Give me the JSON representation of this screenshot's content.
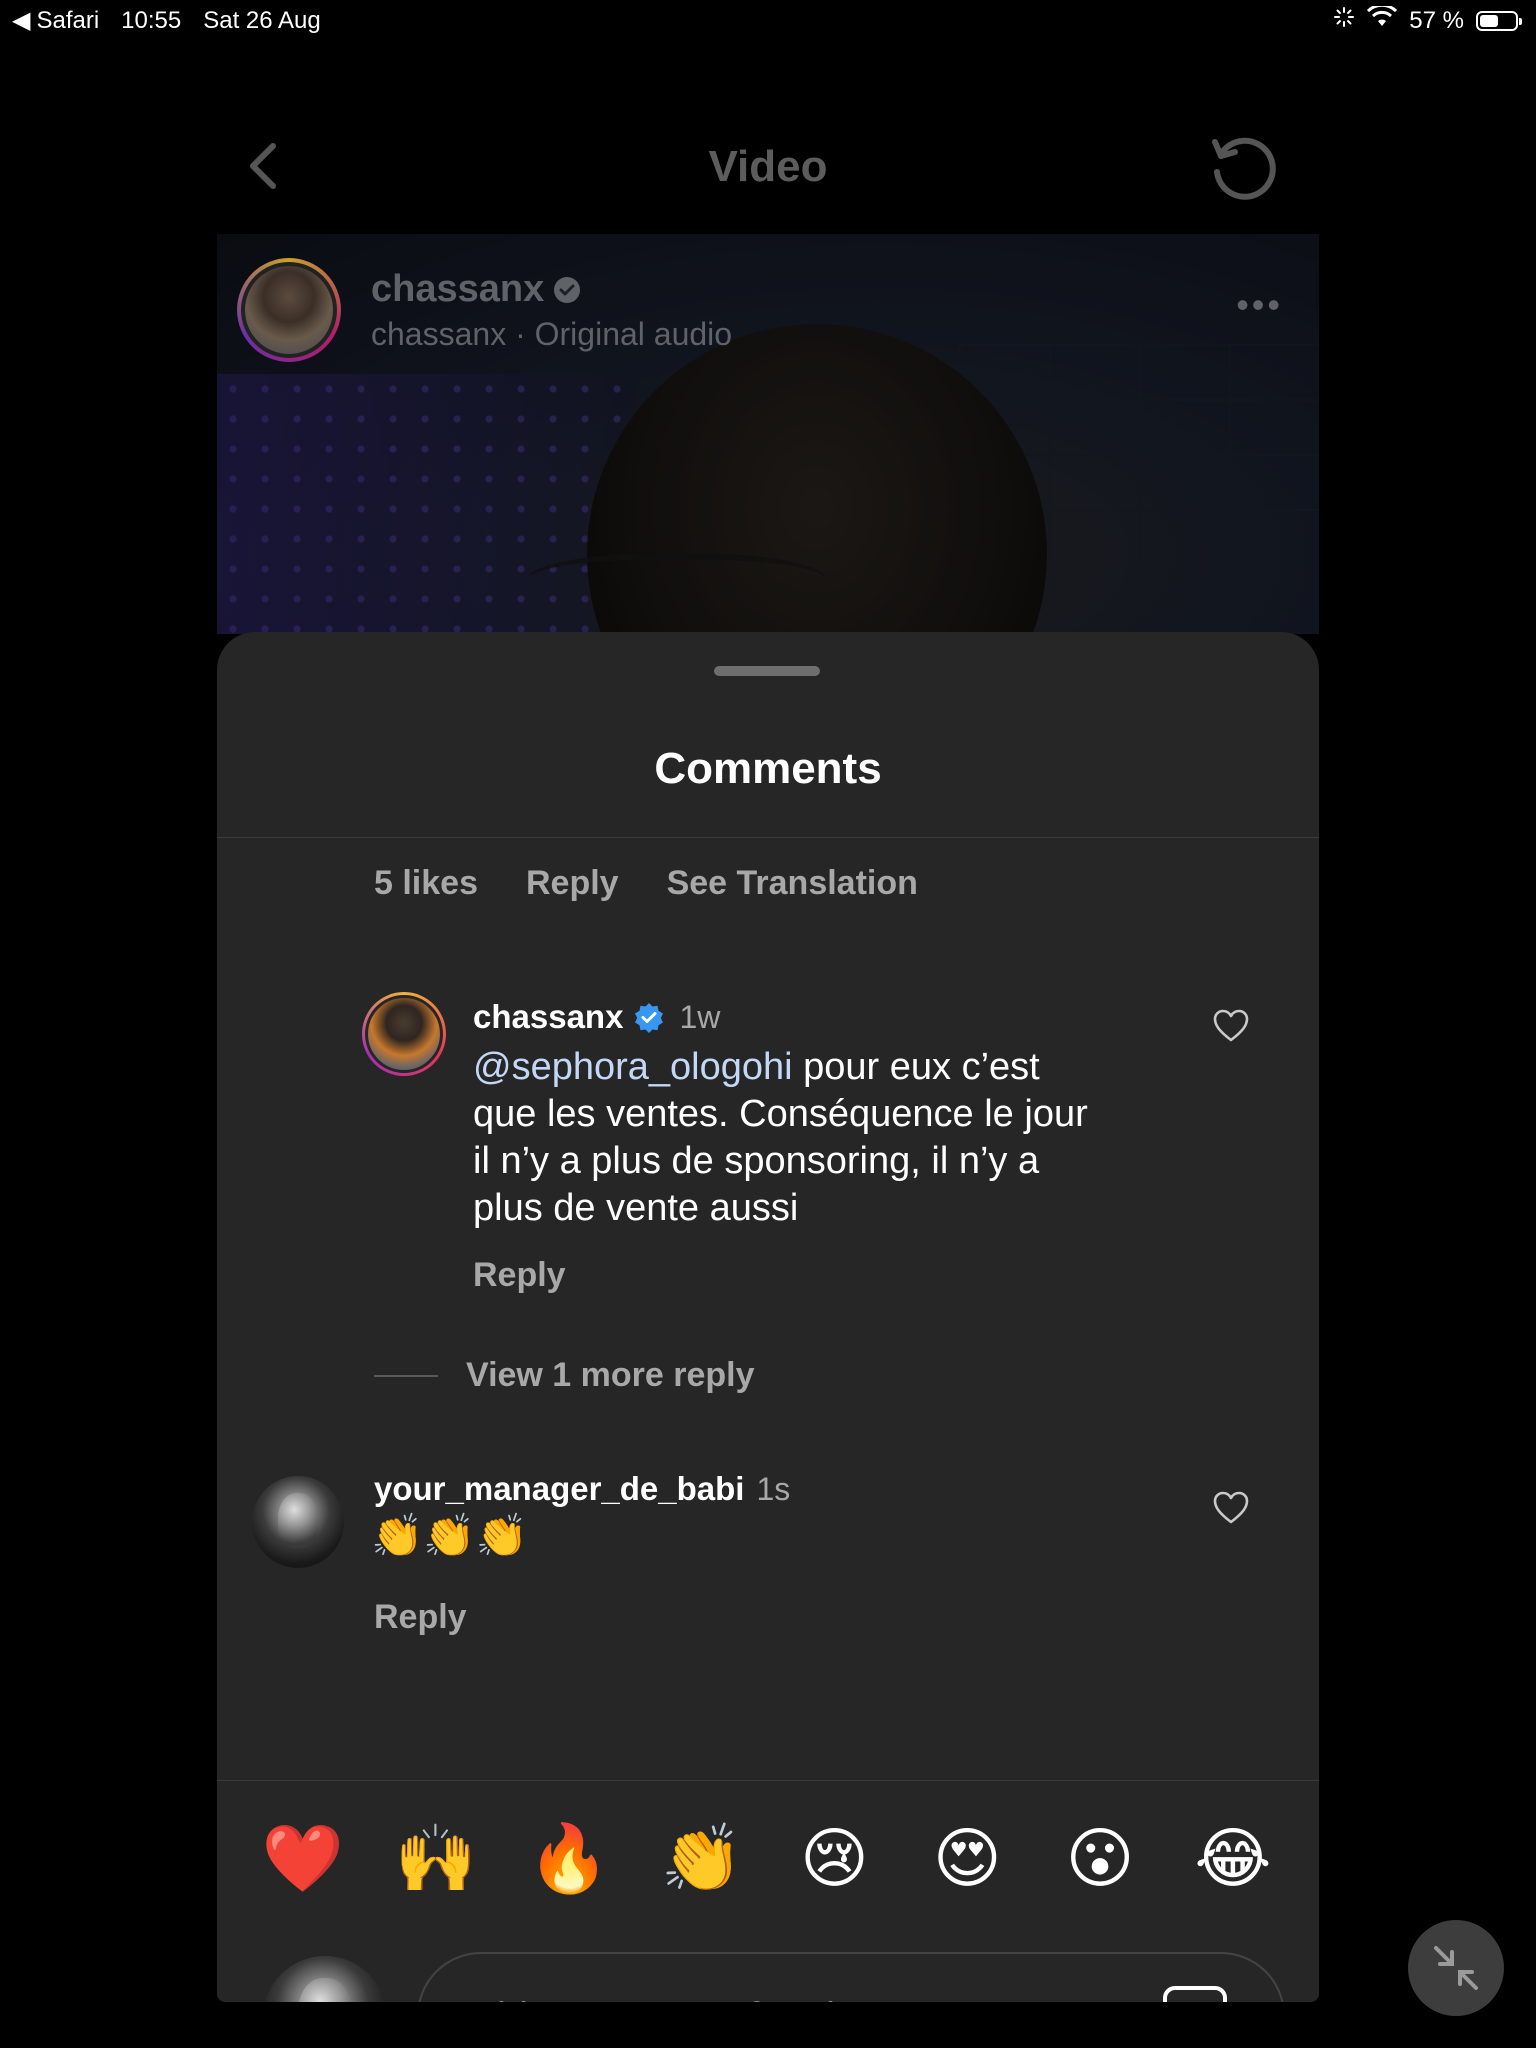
{
  "status_bar": {
    "back_app": "Safari",
    "time": "10:55",
    "date": "Sat 26 Aug",
    "battery_text": "57 %",
    "battery_level": 0.57
  },
  "topbar": {
    "title": "Video",
    "back_icon": "chevron-left-icon",
    "refresh_icon": "refresh-icon"
  },
  "video": {
    "username": "chassanx",
    "subtitle": "chassanx · Original audio",
    "more_icon": "more-dots-icon"
  },
  "comments": {
    "title": "Comments",
    "prev_actions": {
      "likes": "5 likes",
      "reply": "Reply",
      "translate": "See Translation"
    },
    "reply_comment": {
      "username": "chassanx",
      "time": "1w",
      "mention": "@sephora_ologohi",
      "text": " pour eux c’est que les ventes. Conséquence le jour il n’y a plus de sponsoring, il n’y a plus de vente aussi",
      "reply_label": "Reply"
    },
    "view_more": "View 1 more reply",
    "comment2": {
      "username": "your_manager_de_babi",
      "time": "1s",
      "text": "👏👏👏",
      "reply_label": "Reply"
    },
    "quick_emojis": [
      "❤️",
      "🙌",
      "🔥",
      "👏",
      "😢",
      "😍",
      "😮",
      "😂"
    ],
    "composer": {
      "placeholder": "Add a comment for chassanx...",
      "gif_label": "GIF"
    }
  },
  "colors": {
    "sheet_bg": "#262626",
    "secondary_text": "#a8a8a8",
    "mention": "#c3d8f7",
    "verified": "#3897f0"
  }
}
